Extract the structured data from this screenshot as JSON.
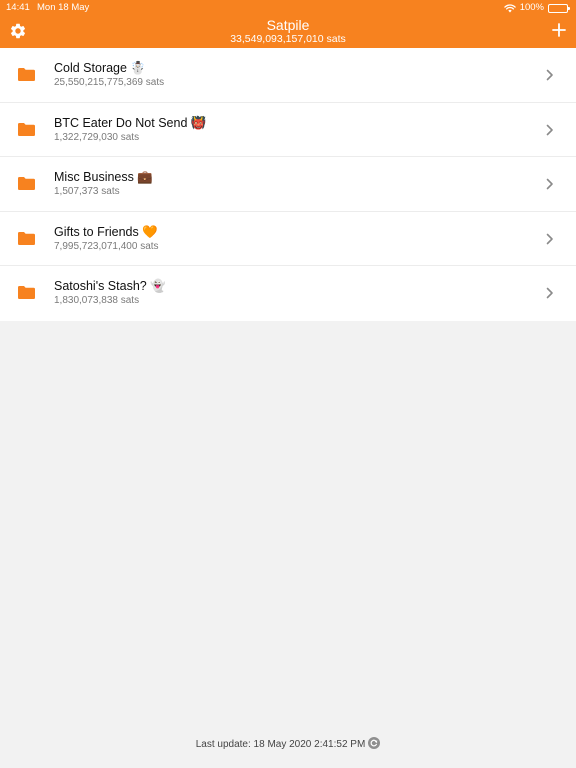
{
  "status_bar": {
    "time": "14:41",
    "date": "Mon 18 May",
    "battery": "100%",
    "icons": [
      "wifi-icon",
      "battery-icon"
    ]
  },
  "header": {
    "title": "Satpile",
    "total": "33,549,093,157,010 sats",
    "left_icon": "gear-icon",
    "right_icon": "plus-icon",
    "color": "#f7821f"
  },
  "wallets": [
    {
      "name": "Cold Storage ☃️",
      "sats": "25,550,215,775,369 sats"
    },
    {
      "name": "BTC Eater Do Not Send 👹",
      "sats": "1,322,729,030 sats"
    },
    {
      "name": "Misc Business 💼",
      "sats": "1,507,373 sats"
    },
    {
      "name": "Gifts to Friends 🧡",
      "sats": "7,995,723,071,400 sats"
    },
    {
      "name": "Satoshi's Stash? 👻",
      "sats": "1,830,073,838 sats"
    }
  ],
  "footer": {
    "last_update": "Last update: 18 May 2020 2:41:52 PM",
    "icon": "refresh-icon"
  }
}
